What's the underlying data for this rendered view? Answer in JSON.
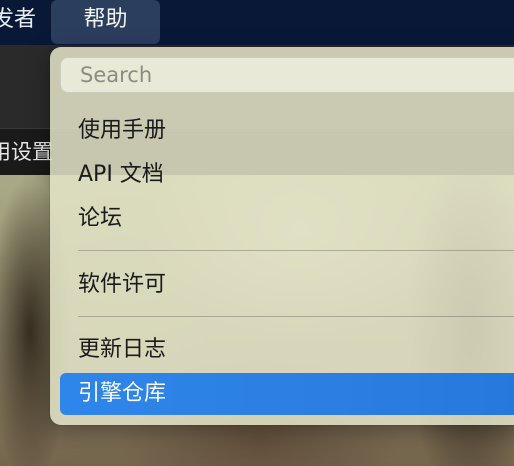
{
  "menubar": {
    "partial_title": "发者",
    "active_menu": "帮助"
  },
  "app": {
    "settings_partial_label": "用设置"
  },
  "help_menu": {
    "search_placeholder": "Search",
    "items": [
      {
        "label": "使用手册"
      },
      {
        "label": "API 文档"
      },
      {
        "label": "论坛"
      },
      {
        "label": "软件许可"
      },
      {
        "label": "更新日志"
      },
      {
        "label": "引擎仓库"
      }
    ],
    "selected_label": "引擎仓库"
  },
  "colors": {
    "menubar_bg": "#081836",
    "active_menu_bg": "#2b3e5e",
    "selection_accent": "#2f86ea"
  }
}
